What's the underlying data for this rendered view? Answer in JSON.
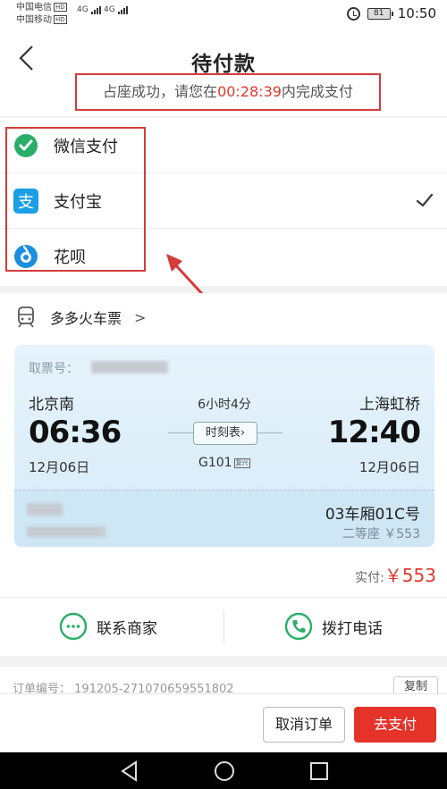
{
  "status_bar": {
    "carrier1": "中国电信",
    "carrier2": "中国移动",
    "hd": "HD",
    "network": "4G",
    "battery": "81",
    "time": "10:50"
  },
  "header": {
    "title": "待付款",
    "notice_prefix": "占座成功，请您在",
    "countdown": "00:28:39",
    "notice_suffix": "内完成支付"
  },
  "payment_methods": [
    {
      "label": "微信支付",
      "icon": "wechat-pay-icon",
      "color": "#2aae67",
      "selected": false
    },
    {
      "label": "支付宝",
      "icon": "alipay-icon",
      "color": "#1c9fe6",
      "selected": true
    },
    {
      "label": "花呗",
      "icon": "huabei-icon",
      "color": "#1a8fe0",
      "selected": false
    }
  ],
  "merchant": {
    "name": "多多火车票",
    "chevron": ">"
  },
  "ticket": {
    "ticket_no_label": "取票号：",
    "from_station": "北京南",
    "to_station": "上海虹桥",
    "depart_time": "06:36",
    "arrive_time": "12:40",
    "depart_date": "12月06日",
    "arrive_date": "12月06日",
    "duration": "6小时4分",
    "timetable": "时刻表",
    "train_no": "G101",
    "train_tag": "复兴",
    "seat_car": "03车厢01C号",
    "seat_class": "二等座 ￥553"
  },
  "pay_total": {
    "label": "实付:",
    "amount": "￥553"
  },
  "contact": {
    "merchant": "联系商家",
    "phone": "拨打电话"
  },
  "order": {
    "label": "订单编号：",
    "number": "191205-271070659551802",
    "copy": "复制"
  },
  "actions": {
    "cancel": "取消订单",
    "pay": "去支付"
  },
  "colors": {
    "accent_red": "#e5332a",
    "highlight_box": "#d43b3b",
    "wechat_green": "#2aae67",
    "alipay_blue": "#1c9fe6"
  }
}
